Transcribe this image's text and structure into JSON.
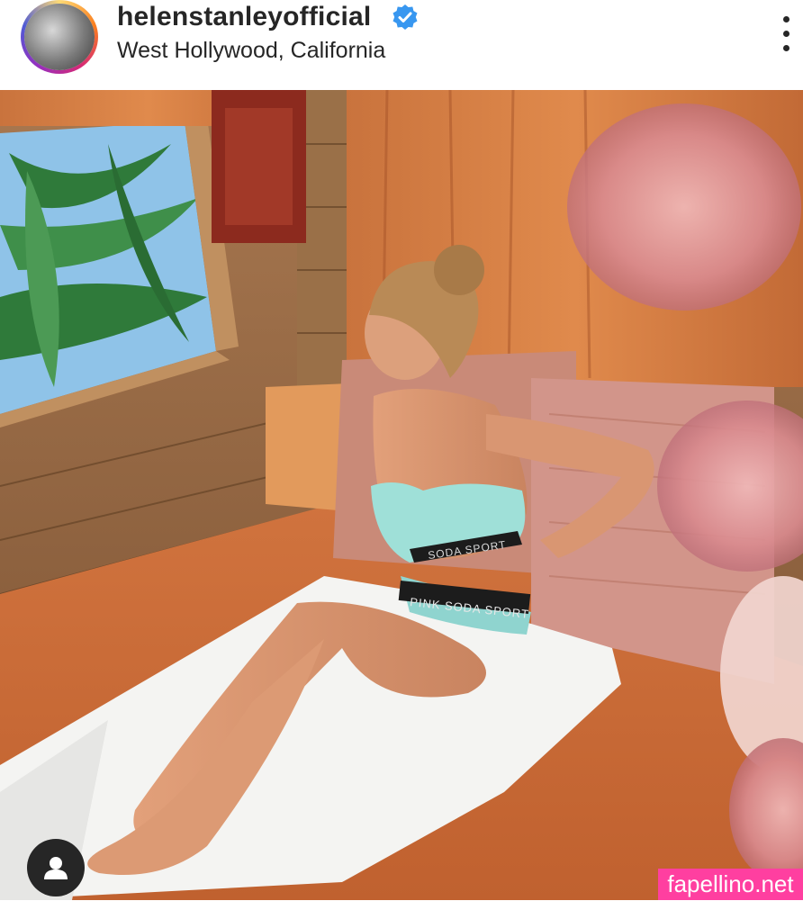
{
  "post_header": {
    "username": "helenstanleyofficial",
    "verified": true,
    "verified_icon": "verified-badge-icon",
    "location": "West Hollywood, California",
    "menu_icon": "more-options-icon"
  },
  "photo": {
    "tag_icon": "user-tag-icon",
    "garment_text_top": "SODA SPORT",
    "garment_text_bottom": "PINK SODA SPORT"
  },
  "watermark": "fapellino.net",
  "colors": {
    "verified_blue": "#3897f0",
    "watermark_pink": "#ff3fa0",
    "text_dark": "#262626"
  }
}
